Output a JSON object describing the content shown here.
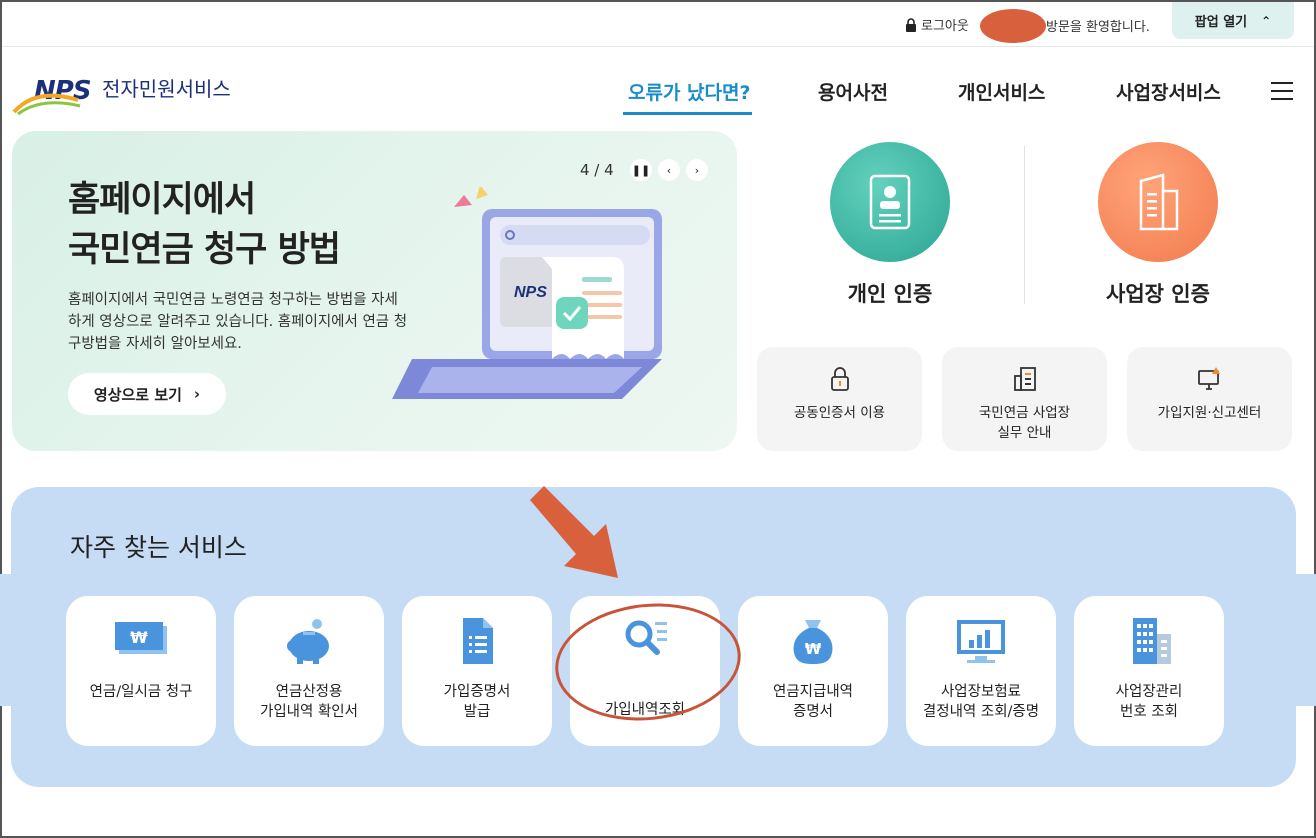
{
  "topbar": {
    "logout_label": "로그아웃",
    "welcome_text": "방문을 환영합니다.",
    "popup_label": "팝업 열기"
  },
  "header": {
    "logo_mark": "NPS",
    "logo_text": "전자민원서비스",
    "nav": [
      "오류가 났다면?",
      "용어사전",
      "개인서비스",
      "사업장서비스"
    ]
  },
  "banner": {
    "title_line1": "홈페이지에서",
    "title_line2": "국민연금 청구 방법",
    "description": "홈페이지에서 국민연금 노령연금 청구하는 방법을 자세하게 영상으로 알려주고 있습니다. 홈페이지에서 연금 청구방법을 자세히 알아보세요.",
    "video_button": "영상으로 보기",
    "pager": "4 / 4",
    "illustration_logo": "NPS"
  },
  "certification": {
    "personal": "개인 인증",
    "business": "사업장 인증"
  },
  "quick_links": [
    {
      "label": "공동인증서 이용",
      "icon": "lock-icon"
    },
    {
      "label": "국민연금 사업장\n실무 안내",
      "icon": "building-doc-icon"
    },
    {
      "label": "가입지원·신고센터",
      "icon": "monitor-alert-icon"
    }
  ],
  "frequent_services": {
    "title": "자주 찾는 서비스",
    "items": [
      {
        "label": "연금/일시금 청구",
        "icon": "won-bill-icon"
      },
      {
        "label": "연금산정용\n가입내역 확인서",
        "icon": "piggy-bank-icon"
      },
      {
        "label": "가입증명서\n발급",
        "icon": "document-icon"
      },
      {
        "label": "가입내역조회",
        "icon": "search-list-icon"
      },
      {
        "label": "연금지급내역\n증명서",
        "icon": "money-bag-icon"
      },
      {
        "label": "사업장보험료\n결정내역 조회/증명",
        "icon": "chart-monitor-icon"
      },
      {
        "label": "사업장관리\n번호 조회",
        "icon": "office-building-icon"
      }
    ]
  },
  "colors": {
    "brand_navy": "#1c2f7a",
    "nav_active": "#1a8cc8",
    "personal_cert": "#3bb8a5",
    "business_cert": "#f48a5a",
    "frequent_bg": "#c6dcf5",
    "annotation": "#d9603d"
  }
}
